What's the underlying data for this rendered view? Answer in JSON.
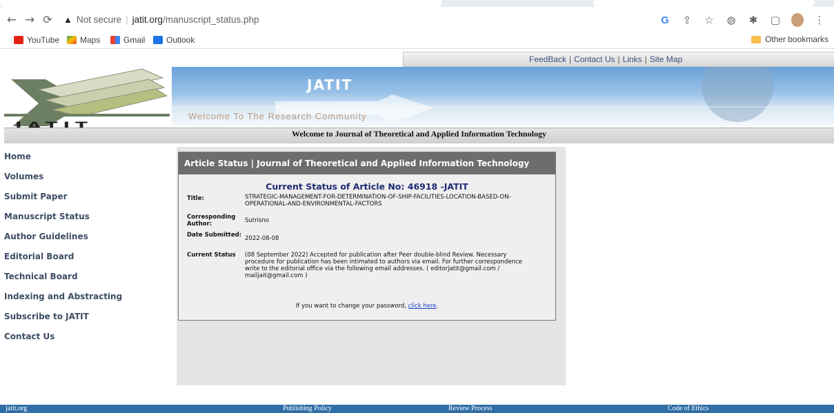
{
  "browser": {
    "url_warning": "Not secure",
    "url_host": "jatit.org",
    "url_path": "/manuscript_status.php",
    "bookmarks": [
      "YouTube",
      "Maps",
      "Gmail",
      "Outlook"
    ],
    "other_bookmarks": "Other bookmarks"
  },
  "header": {
    "links": [
      "FeedBack",
      "Contact Us",
      "Links",
      "Site Map"
    ],
    "logo_text": "JATIT",
    "banner_title": "JATIT",
    "banner_welcome": "Welcome To The Research Community",
    "welcome_line": "Welcome to Journal of Theoretical and Applied Information Technology"
  },
  "sidebar": {
    "items": [
      "Home",
      "Volumes",
      "Submit Paper",
      "Manuscript Status",
      "Author Guidelines",
      "Editorial Board",
      "Technical Board",
      "Indexing and Abstracting",
      "Subscribe to JATIT",
      "Contact Us"
    ]
  },
  "article": {
    "panel_header": "Article Status | Journal of Theoretical and Applied Information Technology",
    "status_title": "Current Status of Article No: 46918 -JATIT",
    "title_label": "Title:",
    "title_value": "STRATEGIC-MANAGEMENT-FOR-DETERMINATION-OF-SHIP-FACILITIES-LOCATION-BASED-ON-OPERATIONAL-AND-ENVIRONMENTAL-FACTORS",
    "author_label": "Corresponding Author:",
    "author_value": "Sutrisno",
    "date_label": "Date Submitted:",
    "date_value": "2022-08-08",
    "status_label": "Current Status",
    "status_value": "(08 September 2022) Accepted for publication after Peer double-blind Review. Necessary procedure for publication has been intimated to authors via email. For further correspondence write to the editorial office via the following email addresses. ( editorjatit@gmail.com / mailjait@gmail.com )",
    "password_text": "If you want to change your password,",
    "password_link": "click here",
    "password_end": "."
  },
  "footer": {
    "site": "jatit.org",
    "items": [
      "Publishing Policy",
      "Review Process",
      "Code of Ethics"
    ]
  }
}
